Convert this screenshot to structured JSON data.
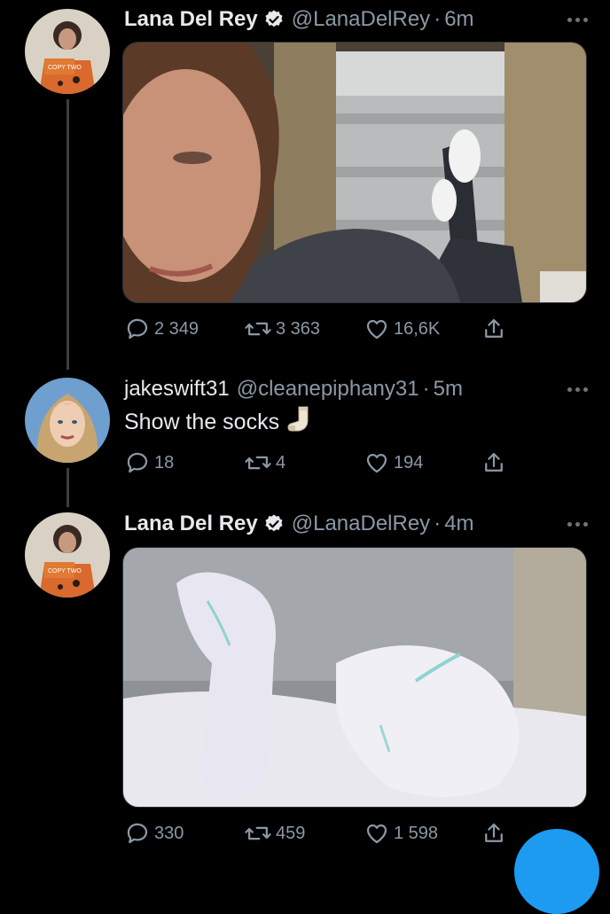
{
  "colors": {
    "background": "#000000",
    "text": "#e7e9ea",
    "muted": "#8b98a5",
    "verified": "#e7e9ea",
    "accent": "#1d9bf0"
  },
  "tweets": [
    {
      "name": "Lana Del Rey",
      "verified": true,
      "handle": "@LanaDelRey",
      "separator": "·",
      "time": "6m",
      "text": "",
      "media": "selfie-with-white-socks-photo",
      "avatar_text": "COPY TWO",
      "replies": "2 349",
      "retweets": "3 363",
      "likes": "16,6K"
    },
    {
      "name": "jakeswift31",
      "verified": false,
      "handle": "@cleanepiphany31",
      "separator": "·",
      "time": "5m",
      "text": "Show the socks",
      "emoji": "sock-emoji",
      "replies": "18",
      "retweets": "4",
      "likes": "194"
    },
    {
      "name": "Lana Del Rey",
      "verified": true,
      "handle": "@LanaDelRey",
      "separator": "·",
      "time": "4m",
      "text": "",
      "media": "white-socks-closeup-photo",
      "avatar_text": "COPY TWO",
      "replies": "330",
      "retweets": "459",
      "likes": "1 598"
    }
  ]
}
